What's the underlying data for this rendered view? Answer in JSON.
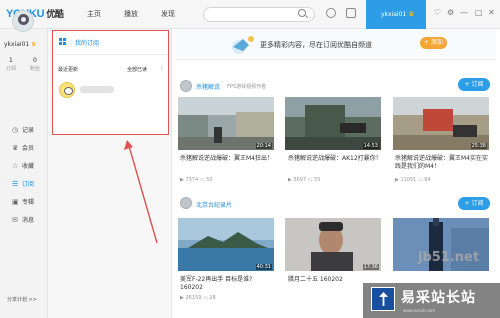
{
  "app": {
    "logo_en": "YOUKU",
    "logo_cn": "优酷",
    "nav": [
      "主页",
      "播放",
      "发现"
    ],
    "username_tab": "ykxiai01",
    "colors": {
      "accent": "#2e9de8",
      "annotation": "#e05353",
      "add_button": "#f5a534"
    }
  },
  "sidebar": {
    "username": "ykxiai01",
    "stats": [
      {
        "value": "1",
        "label": "订阅"
      },
      {
        "value": "0",
        "label": "粉丝"
      }
    ],
    "items": [
      {
        "icon": "clock-icon",
        "label": "记录"
      },
      {
        "icon": "member-icon",
        "label": "会员"
      },
      {
        "icon": "star-icon",
        "label": "收藏"
      },
      {
        "icon": "rss-icon",
        "label": "订阅",
        "active": true
      },
      {
        "icon": "album-icon",
        "label": "专辑"
      },
      {
        "icon": "message-icon",
        "label": "消息"
      }
    ],
    "share": "分享计划 >>"
  },
  "subscriptions": {
    "title": "我的订阅",
    "recent_label": "最近更新",
    "mark_all_read": "全部已读",
    "more": "⋮"
  },
  "banner": {
    "text": "更多精彩内容，尽在订阅优酷自频道",
    "add_button": "+ 添加"
  },
  "channels": [
    {
      "name": "杀猪解说",
      "desc": "FPS游戏视频作者",
      "subscribe": "+ 订阅",
      "videos": [
        {
          "title": "杀猪解说逆战爆破：翼王M4狂出！",
          "duration": "20:14",
          "views": "7374",
          "comments": "52"
        },
        {
          "title": "杀猪解说逆战爆破：AK12打暴你！",
          "duration": "14:53",
          "views": "5697",
          "comments": "55"
        },
        {
          "title": "杀猪解说逆战爆破：翼王M4实在实践是我们的M4！",
          "duration": "25:38",
          "views": "11051",
          "comments": "84"
        }
      ]
    },
    {
      "name": "北京台纪录片",
      "desc": "",
      "subscribe": "+ 订阅",
      "videos": [
        {
          "title": "美军F-22再出手 目标是谁? 160202",
          "duration": "40:31",
          "views": "26159",
          "comments": "28"
        },
        {
          "title": "腊月二十五 160202",
          "duration": "17:36",
          "views": "",
          "comments": ""
        },
        {
          "title": "",
          "duration": "",
          "views": "",
          "comments": ""
        }
      ]
    }
  ],
  "watermark": {
    "url": "jb51.net",
    "name_cn": "易采站长站",
    "name_en": "www.easck.com"
  }
}
